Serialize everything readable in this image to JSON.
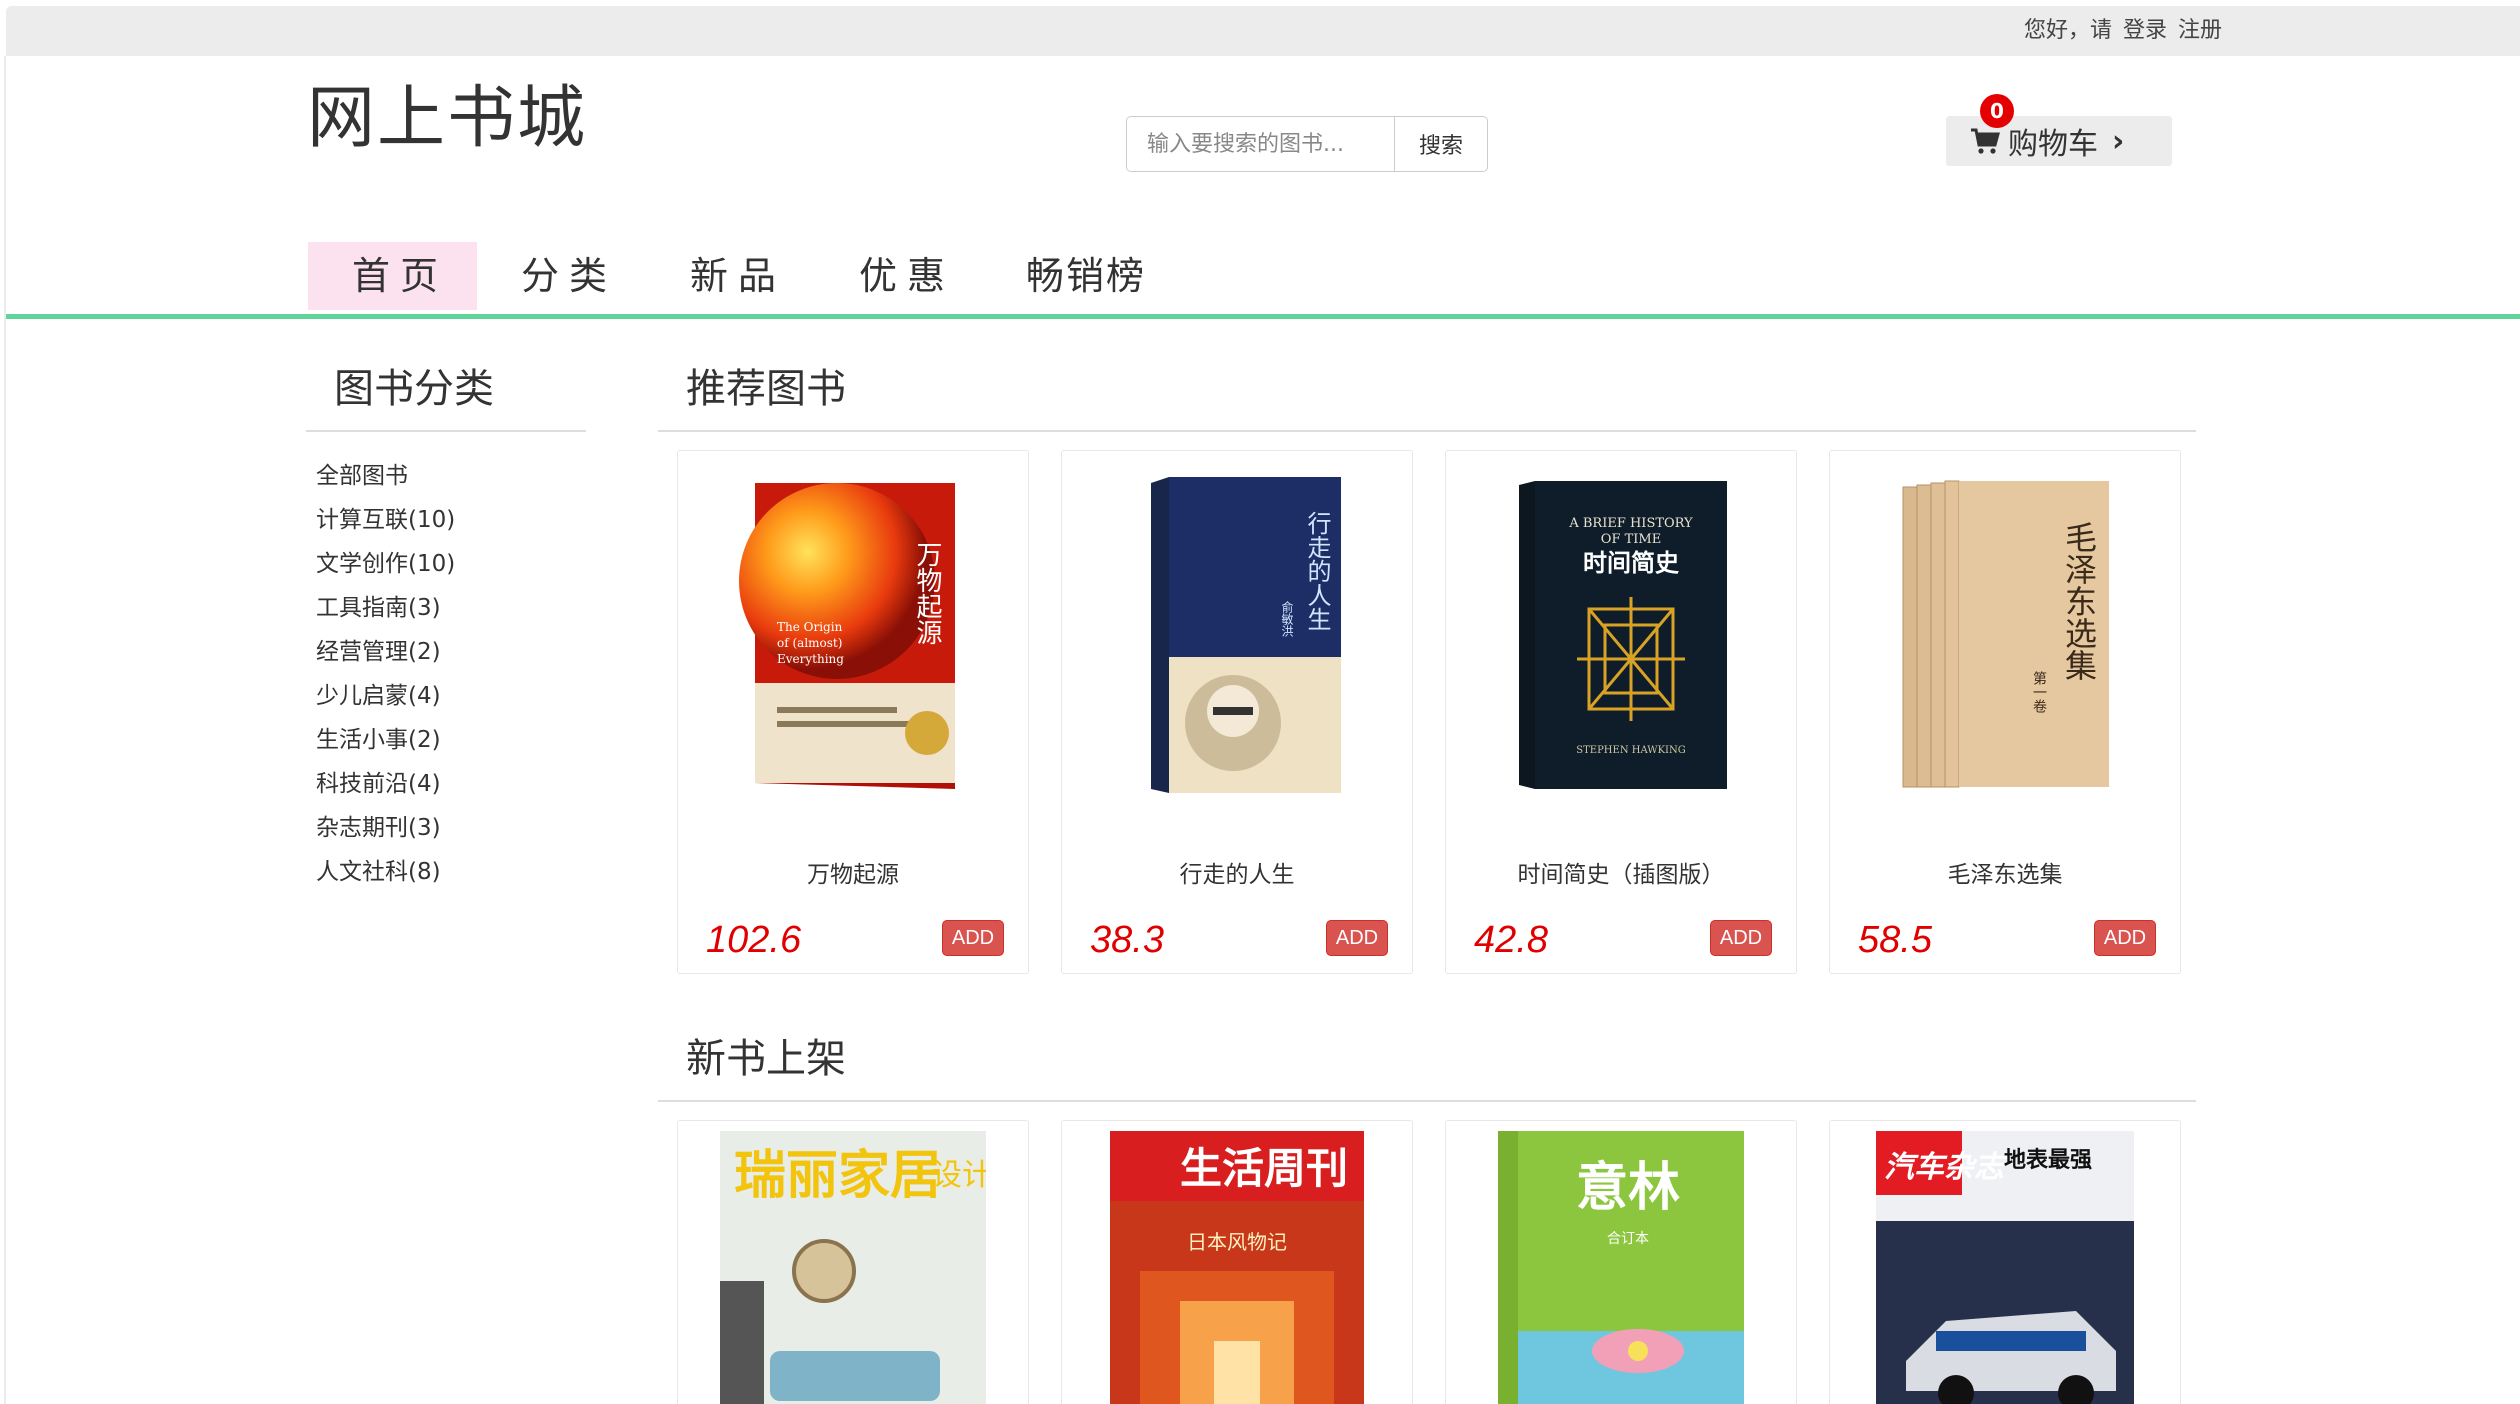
{
  "topbar": {
    "greeting": "您好，请",
    "login": "登录",
    "register": "注册"
  },
  "site": {
    "title": "网上书城"
  },
  "search": {
    "placeholder": "输入要搜索的图书...",
    "button": "搜索"
  },
  "cart": {
    "label": "购物车",
    "count": "0",
    "icon": "shopping-cart-icon"
  },
  "nav": [
    {
      "label": "首页",
      "active": true
    },
    {
      "label": "分类"
    },
    {
      "label": "新品"
    },
    {
      "label": "优惠"
    },
    {
      "label": "畅销榜"
    }
  ],
  "sidebar": {
    "title": "图书分类",
    "items": [
      "全部图书",
      "计算互联(10)",
      "文学创作(10)",
      "工具指南(3)",
      "经营管理(2)",
      "少儿启蒙(4)",
      "生活小事(2)",
      "科技前沿(4)",
      "杂志期刊(3)",
      "人文社科(8)"
    ]
  },
  "recommended": {
    "title": "推荐图书",
    "books": [
      {
        "title": "万物起源",
        "price": "102.6",
        "add": "ADD",
        "cover_title": "万物起源",
        "cover_sub": "The Origin of (almost) Everything"
      },
      {
        "title": "行走的人生",
        "price": "38.3",
        "add": "ADD",
        "cover_title": "行走的人生",
        "cover_sub": "俞敏洪"
      },
      {
        "title": "时间简史（插图版）",
        "price": "42.8",
        "add": "ADD",
        "cover_title": "时间简史",
        "cover_sub": "A BRIEF HISTORY OF TIME"
      },
      {
        "title": "毛泽东选集",
        "price": "58.5",
        "add": "ADD",
        "cover_title": "毛泽东选集",
        "cover_sub": "第一卷"
      }
    ]
  },
  "newbooks": {
    "title": "新书上架",
    "books": [
      {
        "cover_title": "瑞丽家居",
        "cover_sub": "设计"
      },
      {
        "cover_title": "生活周刊",
        "cover_sub": "日本风物记"
      },
      {
        "cover_title": "意林",
        "cover_sub": "合订本"
      },
      {
        "cover_title": "汽车杂志",
        "cover_sub": "地表最强"
      }
    ]
  },
  "colors": {
    "accent_line": "#5fd59b",
    "active_nav": "#fce1ee",
    "price": "#e00000",
    "add_button": "#d9534f",
    "badge": "#e40000"
  }
}
